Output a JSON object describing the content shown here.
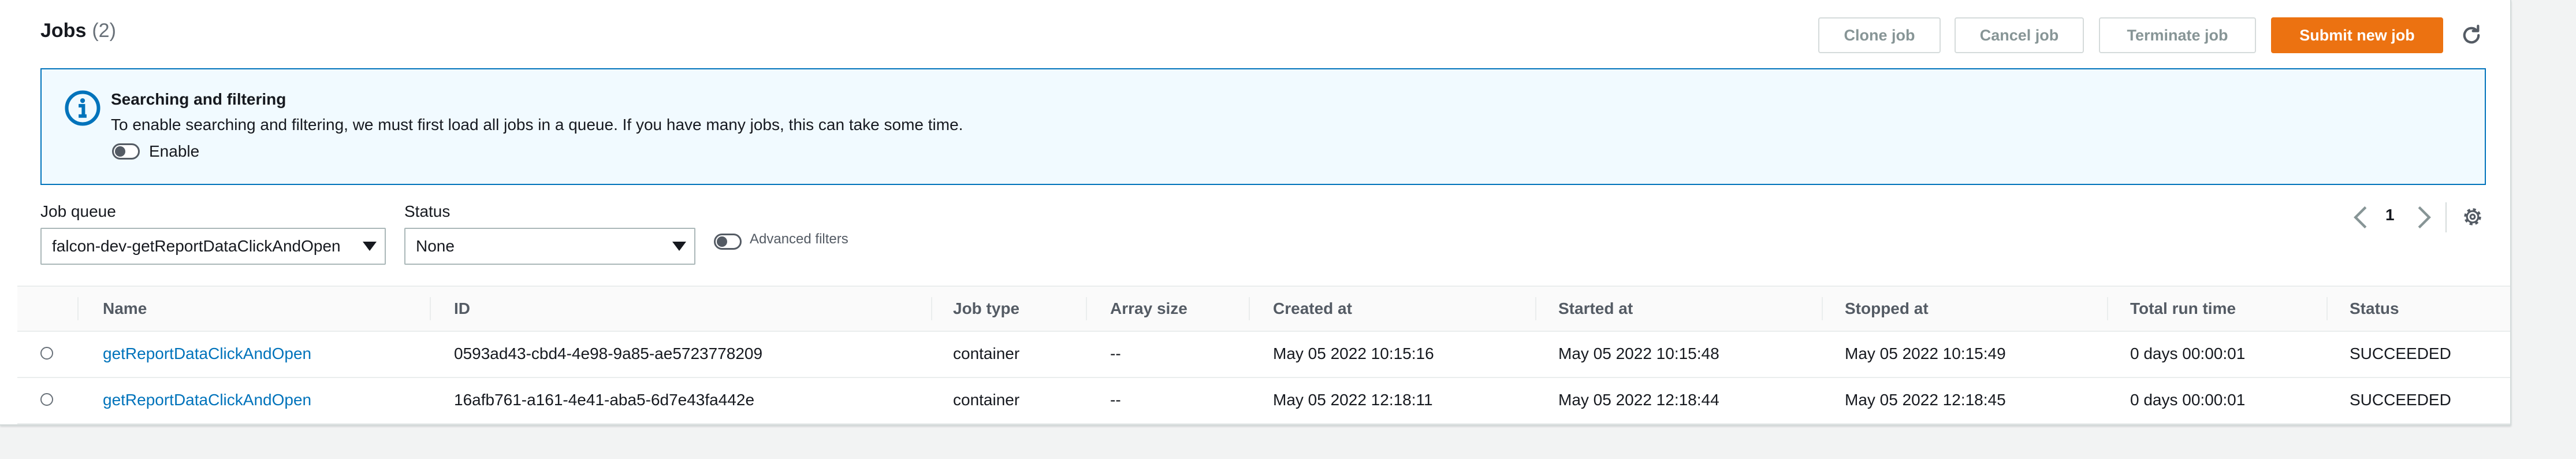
{
  "header": {
    "title": "Jobs",
    "count": "(2)",
    "buttons": {
      "clone": "Clone job",
      "cancel": "Cancel job",
      "terminate": "Terminate job",
      "submit": "Submit new job"
    },
    "refresh_icon": "refresh-icon"
  },
  "info": {
    "icon": "info-icon",
    "title": "Searching and filtering",
    "text": "To enable searching and filtering, we must first load all jobs in a queue. If you have many jobs, this can take some time.",
    "toggle_label": "Enable"
  },
  "filters": {
    "job_queue_label": "Job queue",
    "job_queue_value": "falcon-dev-getReportDataClickAndOpen",
    "status_label": "Status",
    "status_value": "None",
    "advanced_label": "Advanced filters"
  },
  "pagination": {
    "page": "1"
  },
  "table": {
    "columns": [
      "Name",
      "ID",
      "Job type",
      "Array size",
      "Created at",
      "Started at",
      "Stopped at",
      "Total run time",
      "Status"
    ],
    "rows": [
      [
        "getReportDataClickAndOpen",
        "0593ad43-cbd4-4e98-9a85-ae5723778209",
        "container",
        "--",
        "May 05 2022 10:15:16",
        "May 05 2022 10:15:48",
        "May 05 2022 10:15:49",
        "0 days 00:00:01",
        "SUCCEEDED"
      ],
      [
        "getReportDataClickAndOpen",
        "16afb761-a161-4e41-aba5-6d7e43fa442e",
        "container",
        "--",
        "May 05 2022 12:18:11",
        "May 05 2022 12:18:44",
        "May 05 2022 12:18:45",
        "0 days 00:00:01",
        "SUCCEEDED"
      ]
    ]
  },
  "colors": {
    "primary": "#ec7211",
    "link": "#0073bb",
    "info_bg": "#f1faff"
  }
}
